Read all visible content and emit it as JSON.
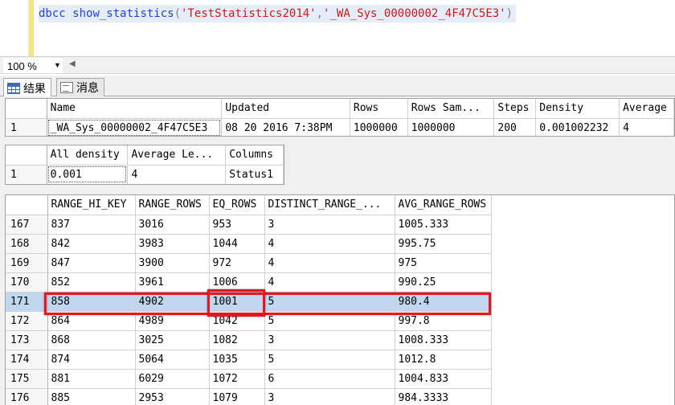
{
  "editor": {
    "keyword": "dbcc",
    "command": "show_statistics",
    "open_paren": "(",
    "arg1": "'TestStatistics2014'",
    "comma": ",",
    "arg2": "'_WA_Sys_00000002_4F47C5E3'",
    "close_paren": ")"
  },
  "zoom": {
    "value": "100 %"
  },
  "tabs": [
    {
      "label": "结果",
      "icon": "grid-icon",
      "active": true
    },
    {
      "label": "消息",
      "icon": "message-icon",
      "active": false
    }
  ],
  "header_grid": {
    "columns": [
      "Name",
      "Updated",
      "Rows",
      "Rows Sam...",
      "Steps",
      "Density",
      "Average"
    ],
    "rows": [
      {
        "row_num": "1",
        "cells": [
          "_WA_Sys_00000002_4F47C5E3",
          "08 20 2016  7:38PM",
          "1000000",
          "1000000",
          "200",
          "0.001002232",
          "4"
        ]
      }
    ]
  },
  "density_grid": {
    "columns": [
      "All density",
      "Average Le...",
      "Columns"
    ],
    "rows": [
      {
        "row_num": "1",
        "cells": [
          "0.001",
          "4",
          "Status1"
        ]
      }
    ]
  },
  "histogram_grid": {
    "columns": [
      "RANGE_HI_KEY",
      "RANGE_ROWS",
      "EQ_ROWS",
      "DISTINCT_RANGE_...",
      "AVG_RANGE_ROWS"
    ],
    "selected_row": "171",
    "rows": [
      {
        "row_num": "167",
        "cells": [
          "837",
          "3016",
          "953",
          "3",
          "1005.333"
        ]
      },
      {
        "row_num": "168",
        "cells": [
          "842",
          "3983",
          "1044",
          "4",
          "995.75"
        ]
      },
      {
        "row_num": "169",
        "cells": [
          "847",
          "3900",
          "972",
          "4",
          "975"
        ]
      },
      {
        "row_num": "170",
        "cells": [
          "852",
          "3961",
          "1006",
          "4",
          "990.25"
        ]
      },
      {
        "row_num": "171",
        "cells": [
          "858",
          "4902",
          "1001",
          "5",
          "980.4"
        ]
      },
      {
        "row_num": "172",
        "cells": [
          "864",
          "4989",
          "1042",
          "5",
          "997.8"
        ]
      },
      {
        "row_num": "173",
        "cells": [
          "868",
          "3025",
          "1082",
          "3",
          "1008.333"
        ]
      },
      {
        "row_num": "174",
        "cells": [
          "874",
          "5064",
          "1035",
          "5",
          "1012.8"
        ]
      },
      {
        "row_num": "175",
        "cells": [
          "881",
          "6029",
          "1072",
          "6",
          "1004.833"
        ]
      },
      {
        "row_num": "176",
        "cells": [
          "885",
          "2953",
          "1079",
          "3",
          "984.3333"
        ]
      }
    ]
  },
  "colors": {
    "highlight_box": "#e8141e",
    "selection": "#bfd7ef",
    "keyword": "#1f3ff0",
    "string": "#d01818"
  }
}
